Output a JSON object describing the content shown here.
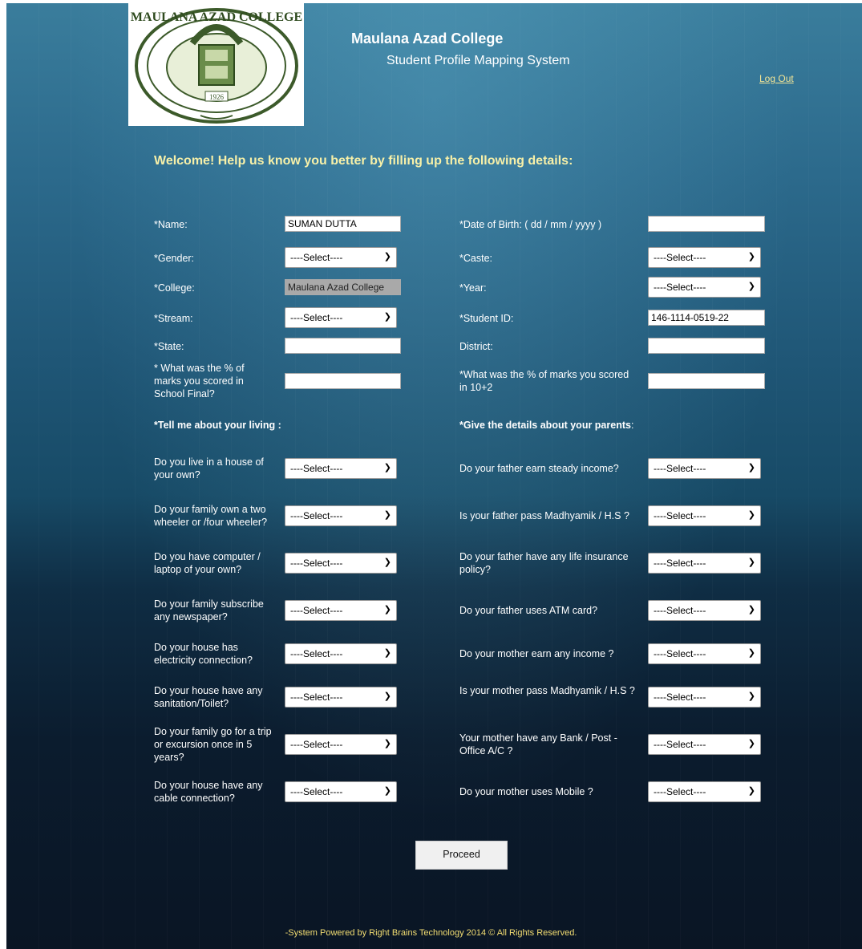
{
  "header": {
    "title": "Maulana Azad College",
    "subtitle": "Student Profile Mapping System",
    "logout": "Log Out",
    "logo_text_top": "MAULANA AZAD COLLEGE",
    "logo_year": "1926"
  },
  "welcome": "Welcome! Help us know you better by filling up the following details:",
  "form": {
    "name_label": "*Name:",
    "name_value": "SUMAN DUTTA",
    "dob_label": "*Date of Birth: ( dd / mm / yyyy )",
    "dob_value": "",
    "gender_label": "*Gender:",
    "caste_label": "*Caste:",
    "college_label": "*College:",
    "college_value": "Maulana Azad College",
    "year_label": "*Year:",
    "stream_label": "*Stream:",
    "student_id_label": "*Student ID:",
    "student_id_value": "146-1114-0519-22",
    "state_label": "*State:",
    "district_label": "District:",
    "school_marks_label": "* What was the % of marks you scored in School Final?",
    "hs_marks_label": "*What was the % of marks you scored in 10+2",
    "select_default": "----Select----"
  },
  "living": {
    "heading": "*Tell me about your living :",
    "questions": [
      "Do you live in a house of your own?",
      "Do your family own a two wheeler or /four wheeler?",
      "Do you have computer / laptop of your own?",
      "Do your family subscribe any newspaper?",
      "Do your house has electricity connection?",
      "Do your house have any sanitation/Toilet?",
      "Do your family go for a trip or excursion once in 5 years?",
      "Do your house have any cable connection?"
    ]
  },
  "parents": {
    "heading": "*Give the details about your parents",
    "heading_suffix": ":",
    "questions": [
      "Do your father earn steady income?",
      "Is your father pass Madhyamik / H.S ?",
      "Do your father have any life insurance policy?",
      "Do your father uses ATM card?",
      "Do your mother earn any income ?",
      "Is your mother pass Madhyamik / H.S ?",
      "Your mother have any Bank / Post - Office A/C ?",
      "Do your mother uses Mobile ?"
    ]
  },
  "proceed": "Proceed",
  "footer": "-System Powered by Right Brains Technology  2014 © All Rights Reserved.",
  "icons": {
    "dropdown": "chevron-down-icon"
  }
}
